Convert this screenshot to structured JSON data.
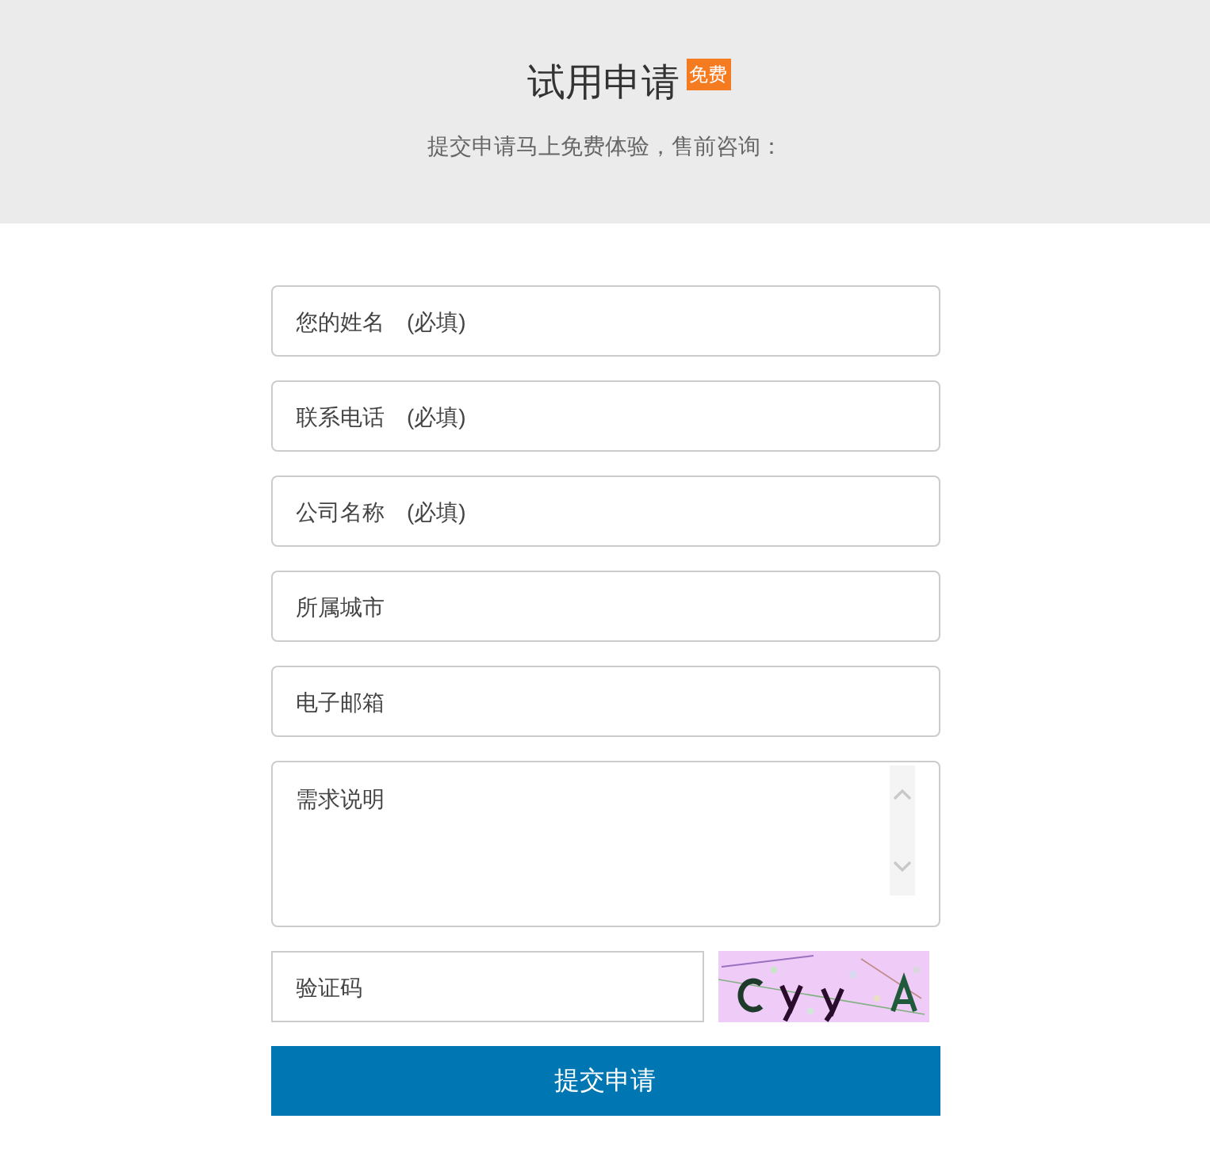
{
  "header": {
    "title": "试用申请",
    "badge": "免费",
    "subtitle": "提交申请马上免费体验，售前咨询："
  },
  "form": {
    "fields": [
      {
        "kind": "input",
        "placeholder": "您的姓名　(必填)"
      },
      {
        "kind": "input",
        "placeholder": "联系电话　(必填)"
      },
      {
        "kind": "input",
        "placeholder": "公司名称　(必填)"
      },
      {
        "kind": "input",
        "placeholder": "所属城市"
      },
      {
        "kind": "input",
        "placeholder": "电子邮箱"
      },
      {
        "kind": "textarea",
        "placeholder": "需求说明"
      }
    ],
    "captcha": {
      "placeholder": "验证码"
    },
    "submit": "提交申请"
  }
}
